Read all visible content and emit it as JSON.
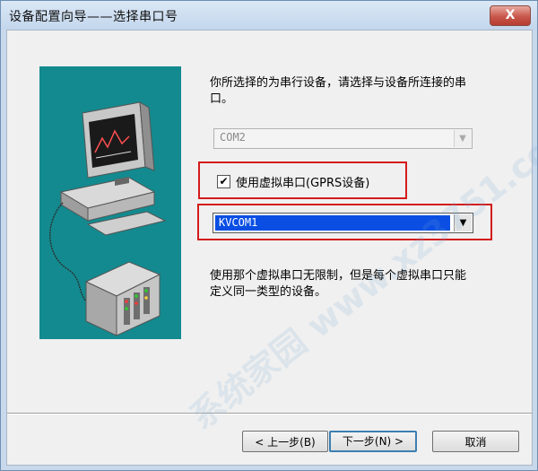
{
  "window": {
    "title": "设备配置向导——选择串口号",
    "close_label": "X"
  },
  "dialog": {
    "intro_text": "你所选择的为串行设备，请选择与设备所连接的串口。",
    "port_combo": {
      "value": "COM2",
      "enabled": false
    },
    "virtual_port_checkbox": {
      "checked": true,
      "label": "使用虚拟串口(GPRS设备)"
    },
    "virtual_port_combo": {
      "value": "KVCOM1",
      "enabled": true
    },
    "note_text": "使用那个虚拟串口无限制，但是每个虚拟串口只能定义同一类型的设备。"
  },
  "buttons": {
    "back": "< 上一步(B)",
    "next": "下一步(N) >",
    "cancel": "取消"
  },
  "icons": {
    "checkbox_mark": "✔",
    "dropdown_arrow": "▼"
  },
  "watermark": {
    "text": "系统家园 www.xz3751.com"
  },
  "colors": {
    "highlight_box": "#d41b1b",
    "illustration_bg": "#138a8f",
    "selection_bg": "#0a4ee3",
    "close_button": "#c9574b"
  }
}
